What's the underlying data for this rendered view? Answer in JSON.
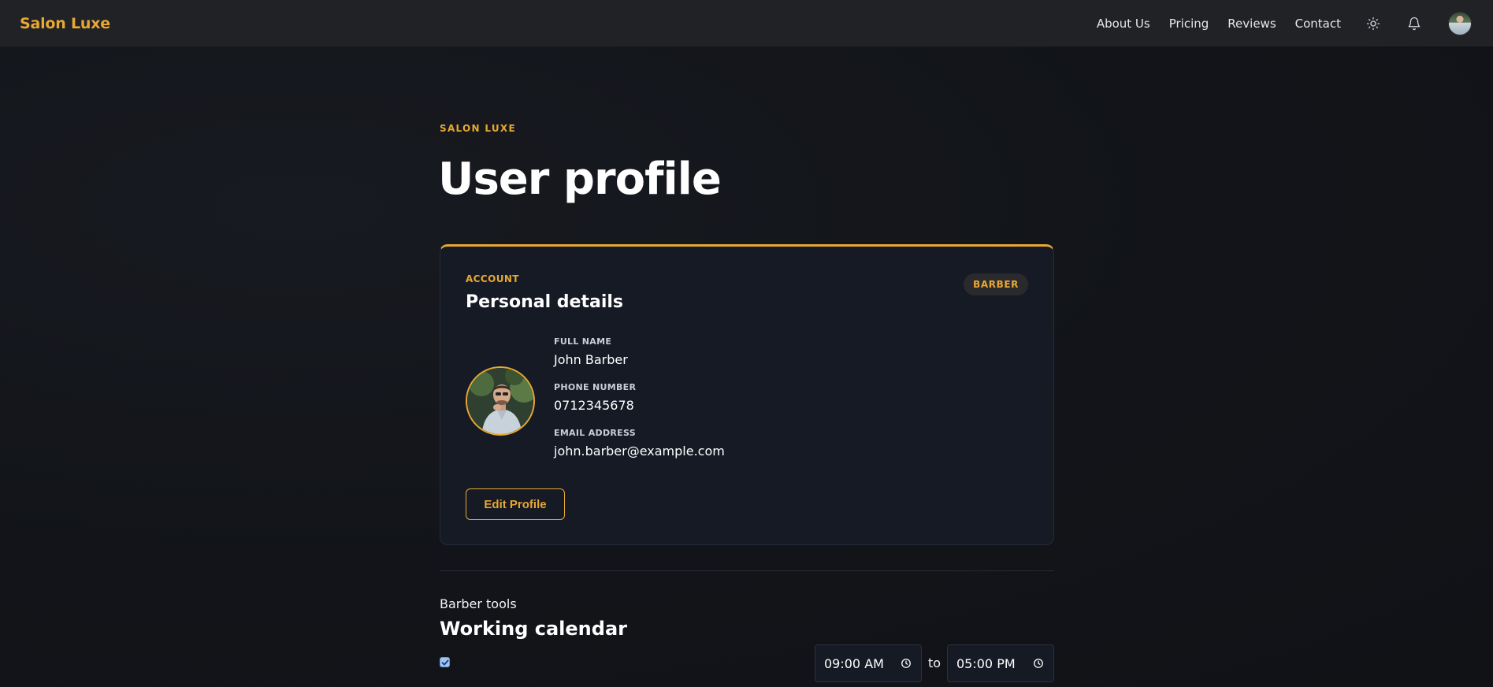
{
  "nav": {
    "brand": "Salon Luxe",
    "links": [
      "About Us",
      "Pricing",
      "Reviews",
      "Contact"
    ],
    "icons": [
      "sun-icon",
      "bell-icon"
    ]
  },
  "page": {
    "eyebrow": "SALON LUXE",
    "title": "User profile"
  },
  "card": {
    "eyebrow": "ACCOUNT",
    "title": "Personal details",
    "role_badge": "BARBER",
    "fields": [
      {
        "label": "FULL NAME",
        "value": "John Barber"
      },
      {
        "label": "PHONE NUMBER",
        "value": "0712345678"
      },
      {
        "label": "EMAIL ADDRESS",
        "value": "john.barber@example.com"
      }
    ],
    "edit_button": "Edit Profile"
  },
  "tools": {
    "label": "Barber tools",
    "title": "Working calendar",
    "day_checked": true,
    "start_time": "09:00 AM",
    "to_text": "to",
    "end_time": "05:00 PM"
  },
  "colors": {
    "accent": "#e8a832",
    "background": "#111318",
    "navbar": "#202226",
    "card": "#151a25"
  }
}
